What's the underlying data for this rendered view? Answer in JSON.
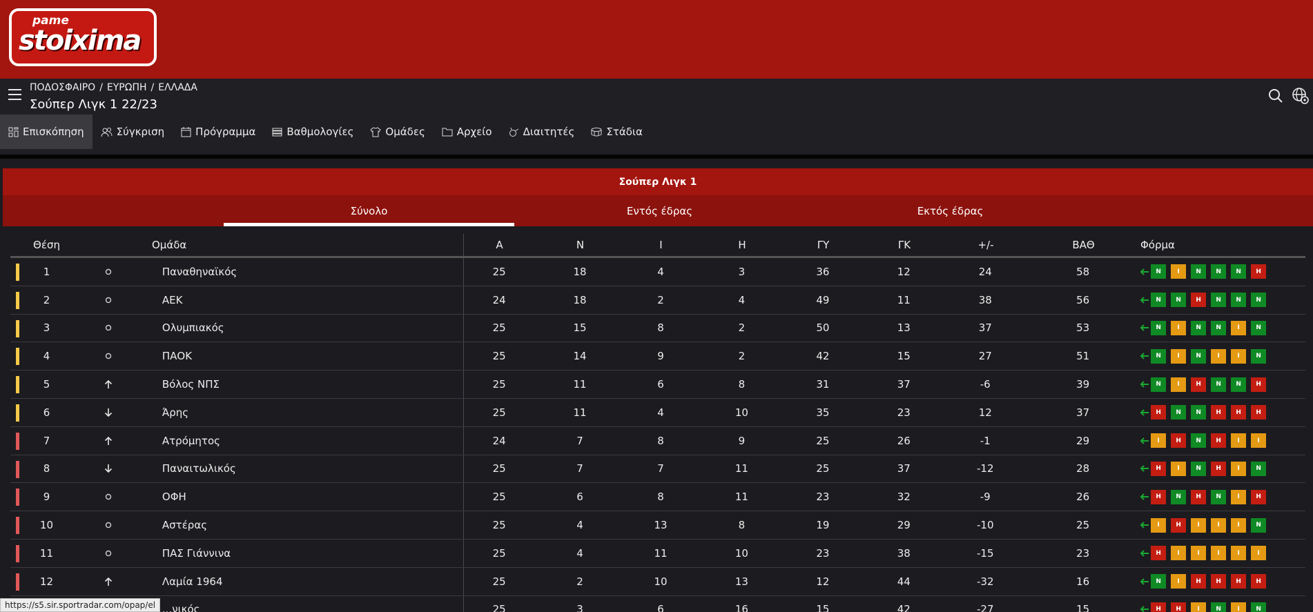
{
  "brand": {
    "logo_top": "pame",
    "logo_main": "stoixima"
  },
  "header": {
    "breadcrumb": [
      "ΠΟΔΟΣΦΑΙΡΟ",
      "ΕΥΡΩΠΗ",
      "ΕΛΛΑΔΑ"
    ],
    "title": "Σούπερ Λιγκ 1 22/23"
  },
  "nav_tabs": [
    {
      "label": "Επισκόπηση",
      "icon": "overview-icon",
      "active": true
    },
    {
      "label": "Σύγκριση",
      "icon": "users-icon"
    },
    {
      "label": "Πρόγραμμα",
      "icon": "calendar-icon"
    },
    {
      "label": "Βαθμολογίες",
      "icon": "list-icon"
    },
    {
      "label": "Ομάδες",
      "icon": "jersey-icon"
    },
    {
      "label": "Αρχείο",
      "icon": "folder-icon"
    },
    {
      "label": "Διαιτητές",
      "icon": "whistle-icon"
    },
    {
      "label": "Στάδια",
      "icon": "stadium-icon"
    }
  ],
  "standings": {
    "title": "Σούπερ Λιγκ 1",
    "subtabs": [
      "Σύνολο",
      "Εντός έδρας",
      "Εκτός έδρας"
    ],
    "active_subtab": 0,
    "columns": {
      "pos": "Θέση",
      "team": "Ομάδα",
      "played": "Α",
      "won": "Ν",
      "drawn": "Ι",
      "lost": "Η",
      "gf": "ΓΥ",
      "ga": "ΓΚ",
      "gd": "+/-",
      "pts": "ΒΑΘ",
      "form": "Φόρμα"
    },
    "zone_colors": {
      "y": "#f5c94a",
      "r": "#e35858"
    },
    "form_colors": {
      "N": "#0f8a24",
      "I": "#e59a13",
      "H": "#c41d12"
    },
    "rows": [
      {
        "pos": "1",
        "move": "same",
        "team": "Παναθηναϊκός",
        "played": "25",
        "won": "18",
        "drawn": "4",
        "lost": "3",
        "gf": "36",
        "ga": "12",
        "gd": "24",
        "pts": "58",
        "zone": "y",
        "form": [
          "N",
          "I",
          "N",
          "N",
          "N",
          "H"
        ]
      },
      {
        "pos": "2",
        "move": "same",
        "team": "ΑΕΚ",
        "played": "24",
        "won": "18",
        "drawn": "2",
        "lost": "4",
        "gf": "49",
        "ga": "11",
        "gd": "38",
        "pts": "56",
        "zone": "y",
        "form": [
          "N",
          "N",
          "H",
          "N",
          "N",
          "N"
        ]
      },
      {
        "pos": "3",
        "move": "same",
        "team": "Ολυμπιακός",
        "played": "25",
        "won": "15",
        "drawn": "8",
        "lost": "2",
        "gf": "50",
        "ga": "13",
        "gd": "37",
        "pts": "53",
        "zone": "y",
        "form": [
          "N",
          "I",
          "N",
          "N",
          "I",
          "N"
        ]
      },
      {
        "pos": "4",
        "move": "same",
        "team": "ΠΑΟΚ",
        "played": "25",
        "won": "14",
        "drawn": "9",
        "lost": "2",
        "gf": "42",
        "ga": "15",
        "gd": "27",
        "pts": "51",
        "zone": "y",
        "form": [
          "N",
          "I",
          "N",
          "I",
          "I",
          "N"
        ]
      },
      {
        "pos": "5",
        "move": "up",
        "team": "Βόλος ΝΠΣ",
        "played": "25",
        "won": "11",
        "drawn": "6",
        "lost": "8",
        "gf": "31",
        "ga": "37",
        "gd": "-6",
        "pts": "39",
        "zone": "y",
        "form": [
          "N",
          "I",
          "H",
          "N",
          "N",
          "H"
        ]
      },
      {
        "pos": "6",
        "move": "down",
        "team": "Άρης",
        "played": "25",
        "won": "11",
        "drawn": "4",
        "lost": "10",
        "gf": "35",
        "ga": "23",
        "gd": "12",
        "pts": "37",
        "zone": "y",
        "form": [
          "H",
          "N",
          "N",
          "H",
          "H",
          "H"
        ]
      },
      {
        "pos": "7",
        "move": "up",
        "team": "Ατρόμητος",
        "played": "24",
        "won": "7",
        "drawn": "8",
        "lost": "9",
        "gf": "25",
        "ga": "26",
        "gd": "-1",
        "pts": "29",
        "zone": "r",
        "form": [
          "I",
          "H",
          "N",
          "H",
          "I",
          "I"
        ]
      },
      {
        "pos": "8",
        "move": "down",
        "team": "Παναιτωλικός",
        "played": "25",
        "won": "7",
        "drawn": "7",
        "lost": "11",
        "gf": "25",
        "ga": "37",
        "gd": "-12",
        "pts": "28",
        "zone": "r",
        "form": [
          "H",
          "I",
          "N",
          "H",
          "I",
          "N"
        ]
      },
      {
        "pos": "9",
        "move": "same",
        "team": "ΟΦΗ",
        "played": "25",
        "won": "6",
        "drawn": "8",
        "lost": "11",
        "gf": "23",
        "ga": "32",
        "gd": "-9",
        "pts": "26",
        "zone": "r",
        "form": [
          "H",
          "N",
          "H",
          "N",
          "I",
          "H"
        ]
      },
      {
        "pos": "10",
        "move": "same",
        "team": "Αστέρας",
        "played": "25",
        "won": "4",
        "drawn": "13",
        "lost": "8",
        "gf": "19",
        "ga": "29",
        "gd": "-10",
        "pts": "25",
        "zone": "r",
        "form": [
          "I",
          "H",
          "I",
          "I",
          "I",
          "N"
        ]
      },
      {
        "pos": "11",
        "move": "same",
        "team": "ΠΑΣ Γιάννινα",
        "played": "25",
        "won": "4",
        "drawn": "11",
        "lost": "10",
        "gf": "23",
        "ga": "38",
        "gd": "-15",
        "pts": "23",
        "zone": "r",
        "form": [
          "H",
          "I",
          "I",
          "I",
          "I",
          "I"
        ]
      },
      {
        "pos": "12",
        "move": "up",
        "team": "Λαμία 1964",
        "played": "25",
        "won": "2",
        "drawn": "10",
        "lost": "13",
        "gf": "12",
        "ga": "44",
        "gd": "-32",
        "pts": "16",
        "zone": "r",
        "form": [
          "N",
          "I",
          "H",
          "H",
          "H",
          "H"
        ]
      },
      {
        "pos": "",
        "move": "",
        "team": "...νικός",
        "played": "25",
        "won": "3",
        "drawn": "6",
        "lost": "16",
        "gf": "15",
        "ga": "42",
        "gd": "-27",
        "pts": "15",
        "zone": "r",
        "form": [
          "H",
          "H",
          "I",
          "N",
          "I",
          "N"
        ]
      }
    ]
  },
  "status_url": "https://s5.sir.sportradar.com/opap/el"
}
